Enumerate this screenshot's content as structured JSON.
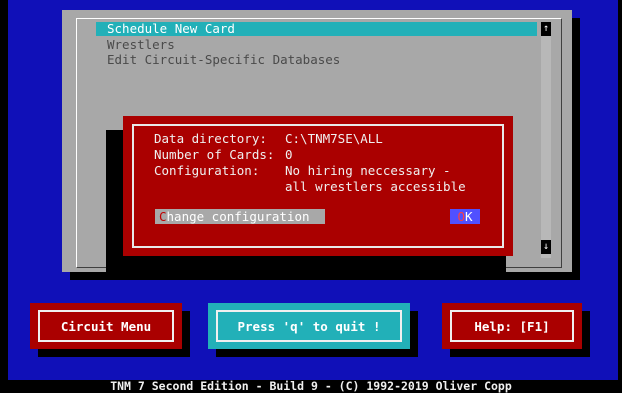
{
  "menu": {
    "items": [
      {
        "label": "Schedule New Card",
        "selected": true
      },
      {
        "label": "Wrestlers",
        "selected": false
      },
      {
        "label": "Edit Circuit-Specific Databases",
        "selected": false
      }
    ]
  },
  "scrollbar": {
    "up_arrow": "↑",
    "down_arrow": "↓"
  },
  "dialog": {
    "data_directory_label": "Data directory:",
    "data_directory_value": "C:\\TNM7SE\\ALL",
    "cards_label": "Number of Cards:",
    "cards_value": "0",
    "config_label": "Configuration:",
    "config_value_line1": "No hiring neccessary -",
    "config_value_line2": "all wrestlers accessible",
    "change_hotkey": "C",
    "change_rest": "hange configuration",
    "ok_hotkey": "O",
    "ok_rest": "K"
  },
  "buttons": {
    "circuit_menu": "Circuit Menu",
    "quit": "Press 'q' to quit !",
    "help": "Help: [F1]"
  },
  "footer": "TNM 7 Second Edition - Build 9 - (C) 1992-2019 Oliver Copp",
  "colors": {
    "background": "#1010b8",
    "dialog": "#aa0000",
    "highlight": "#22b0b8",
    "window": "#a8a8a8"
  }
}
